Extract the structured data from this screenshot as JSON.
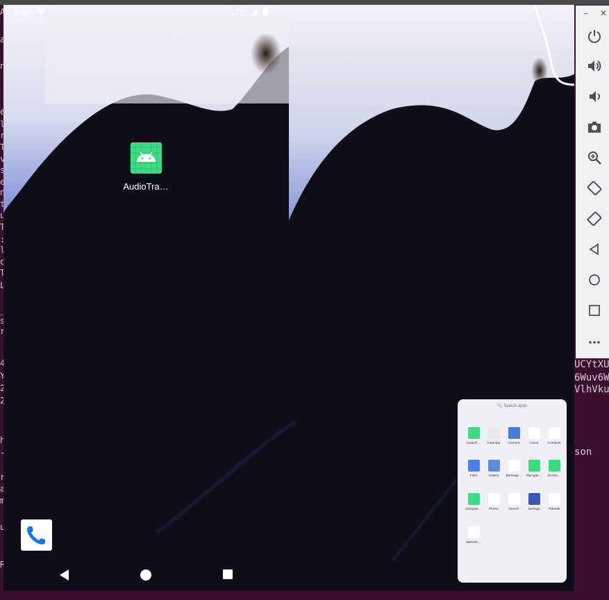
{
  "terminal": {
    "left_chars": [
      "A",
      "a",
      "n",
      "e",
      "l",
      "r",
      "T",
      "v",
      "s",
      "e",
      "n",
      "t",
      "u",
      "T",
      ":",
      "l",
      "o",
      "T",
      "L",
      "_",
      "s",
      "r",
      "4",
      "Y",
      "2",
      "2",
      "h",
      "-",
      "r",
      "a",
      "m",
      "u",
      "R"
    ],
    "right_lines": [
      "UCYtXU",
      "6Wuv6W",
      "VlhVku",
      "son"
    ]
  },
  "status_bar": {
    "time": "9:45",
    "network": "LTE"
  },
  "home": {
    "app_label": "AudioTra…",
    "dock_icon": "phone-icon"
  },
  "nav": {
    "back": "back-icon",
    "home": "home-icon",
    "recents": "recents-icon"
  },
  "drawer": {
    "search_placeholder": "Search apps",
    "apps": [
      {
        "label": "AudioTr…",
        "color": "#3ddc84"
      },
      {
        "label": "Calendar",
        "color": "#e9e9e9"
      },
      {
        "label": "Camera",
        "color": "#4a7bd6"
      },
      {
        "label": "Clock",
        "color": "#ffffff"
      },
      {
        "label": "Contacts",
        "color": "#ffffff"
      },
      {
        "label": "Files",
        "color": "#4a80e8"
      },
      {
        "label": "Gallery",
        "color": "#5b8be0"
      },
      {
        "label": "Messagi…",
        "color": "#ffffff"
      },
      {
        "label": "MyAppli…",
        "color": "#3ddc84"
      },
      {
        "label": "NoActi…",
        "color": "#3ddc84"
      },
      {
        "label": "NoSplas…",
        "color": "#3ddc84"
      },
      {
        "label": "Phone",
        "color": "#ffffff"
      },
      {
        "label": "Search",
        "color": "#ffffff"
      },
      {
        "label": "Settings",
        "color": "#3b57b5"
      },
      {
        "label": "TMobile",
        "color": "#ffffff"
      },
      {
        "label": "WebVie…",
        "color": "#ffffff"
      }
    ]
  },
  "toolbar": {
    "minimize": "–",
    "close": "✕",
    "buttons": [
      "power-icon",
      "volume-up-icon",
      "volume-down-icon",
      "camera-icon",
      "zoom-icon",
      "rotate-left-icon",
      "rotate-right-icon",
      "back-icon",
      "home-icon",
      "overview-icon",
      "more-icon"
    ]
  }
}
